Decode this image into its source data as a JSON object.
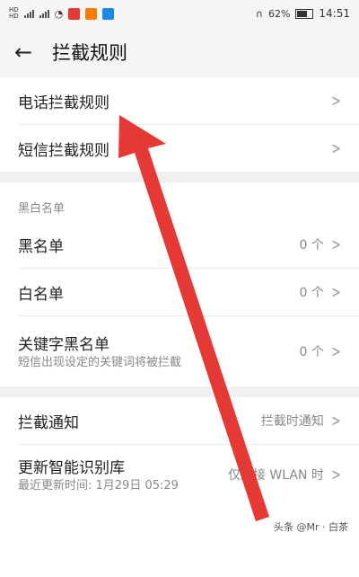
{
  "status": {
    "net_labels": [
      "HD",
      "HD"
    ],
    "battery": "62%",
    "time": "14:51"
  },
  "header": {
    "back_icon": "arrow-left-icon",
    "title": "拦截规则"
  },
  "rules": [
    {
      "label": "电话拦截规则"
    },
    {
      "label": "短信拦截规则"
    }
  ],
  "blackwhite": {
    "heading": "黑白名单",
    "items": [
      {
        "label": "黑名单",
        "value": "0 个"
      },
      {
        "label": "白名单",
        "value": "0 个"
      },
      {
        "label": "关键字黑名单",
        "sub": "短信出现设定的关键词将被拦截",
        "value": "0 个"
      }
    ]
  },
  "settings": {
    "notify": {
      "label": "拦截通知",
      "value": "拦截时通知"
    },
    "update": {
      "label": "更新智能识别库",
      "sub": "最近更新时间: 1月29日 05:29",
      "value": "仅连接 WLAN 时"
    }
  },
  "watermark": "头条 @Mr · 白茶",
  "colors": {
    "arrow": "#e53935"
  }
}
